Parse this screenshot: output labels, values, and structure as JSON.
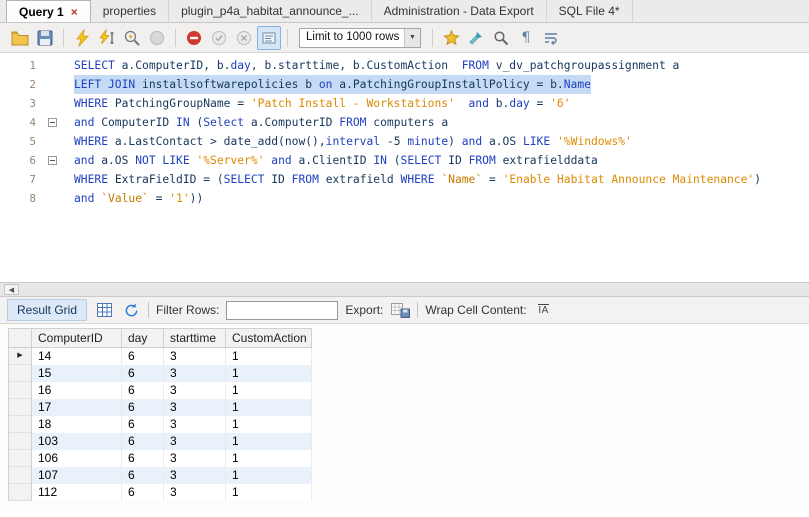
{
  "colors": {
    "keyword": "#2040c0",
    "identifier": "#16365c",
    "string": "#dd8a00",
    "backtick": "#c77c00",
    "line_number": "#9b8671",
    "selected_line_bg": "#c5dbf5",
    "alt_row_bg": "#e9f1fb"
  },
  "tab_bar": {
    "tabs": [
      {
        "label": "Query 1",
        "active": true,
        "close": "×"
      },
      {
        "label": "properties",
        "active": false
      },
      {
        "label": "plugin_p4a_habitat_announce_...",
        "active": false
      },
      {
        "label": "Administration - Data Export",
        "active": false
      },
      {
        "label": "SQL File 4*",
        "active": false
      }
    ]
  },
  "toolbar": {
    "items": [
      {
        "icon": "open-script-icon"
      },
      {
        "icon": "save-script-icon"
      },
      {
        "sep": true
      },
      {
        "icon": "execute-icon"
      },
      {
        "icon": "execute-current-icon"
      },
      {
        "icon": "explain-icon"
      },
      {
        "icon": "stop-icon",
        "disabled": true
      },
      {
        "sep": true
      },
      {
        "icon": "stop-on-error-icon"
      },
      {
        "icon": "commit-icon",
        "disabled": true
      },
      {
        "icon": "rollback-icon",
        "disabled": true
      },
      {
        "icon": "autocommit-icon",
        "toggled": true
      },
      {
        "sep": true
      },
      {
        "dropdown": "Limit to 1000 rows"
      },
      {
        "sep": true
      },
      {
        "icon": "save-snippet-icon"
      },
      {
        "icon": "beautify-icon"
      },
      {
        "icon": "find-icon"
      },
      {
        "icon": "invisible-chars-icon"
      },
      {
        "icon": "wrap-text-icon"
      }
    ]
  },
  "editor": {
    "lines": [
      {
        "num": "1",
        "fold": false,
        "selected": false,
        "segments": [
          {
            "t": "kw",
            "v": "SELECT"
          },
          {
            "t": "id",
            "v": " a.ComputerID, b."
          },
          {
            "t": "kw",
            "v": "day"
          },
          {
            "t": "id",
            "v": ", b.starttime, b.CustomAction  "
          },
          {
            "t": "kw",
            "v": "FROM"
          },
          {
            "t": "id",
            "v": " v_dv_patchgroupassignment a"
          }
        ]
      },
      {
        "num": "2",
        "fold": false,
        "selected": true,
        "segments": [
          {
            "t": "kw",
            "v": "LEFT JOIN"
          },
          {
            "t": "id",
            "v": " installsoftwarepolicies b "
          },
          {
            "t": "kw",
            "v": "on"
          },
          {
            "t": "id",
            "v": " a.PatchingGroupInstallPolicy = b."
          },
          {
            "t": "kw",
            "v": "Name"
          }
        ]
      },
      {
        "num": "3",
        "fold": false,
        "selected": false,
        "segments": [
          {
            "t": "kw",
            "v": "WHERE"
          },
          {
            "t": "id",
            "v": " PatchingGroupName = "
          },
          {
            "t": "str",
            "v": "'Patch Install - Workstations'"
          },
          {
            "t": "id",
            "v": "  "
          },
          {
            "t": "kw",
            "v": "and"
          },
          {
            "t": "id",
            "v": " b."
          },
          {
            "t": "kw",
            "v": "day"
          },
          {
            "t": "id",
            "v": " = "
          },
          {
            "t": "str",
            "v": "'6'"
          }
        ]
      },
      {
        "num": "4",
        "fold": true,
        "selected": false,
        "segments": [
          {
            "t": "kw",
            "v": "and"
          },
          {
            "t": "id",
            "v": " ComputerID "
          },
          {
            "t": "kw",
            "v": "IN"
          },
          {
            "t": "id",
            "v": " ("
          },
          {
            "t": "kw",
            "v": "Select"
          },
          {
            "t": "id",
            "v": " a.ComputerID "
          },
          {
            "t": "kw",
            "v": "FROM"
          },
          {
            "t": "id",
            "v": " computers a"
          }
        ]
      },
      {
        "num": "5",
        "fold": false,
        "selected": false,
        "segments": [
          {
            "t": "kw",
            "v": "WHERE"
          },
          {
            "t": "id",
            "v": " a.LastContact > date_add(now(),"
          },
          {
            "t": "kw",
            "v": "interval"
          },
          {
            "t": "id",
            "v": " -5 "
          },
          {
            "t": "kw",
            "v": "minute"
          },
          {
            "t": "id",
            "v": ") "
          },
          {
            "t": "kw",
            "v": "and"
          },
          {
            "t": "id",
            "v": " a.OS "
          },
          {
            "t": "kw",
            "v": "LIKE"
          },
          {
            "t": "id",
            "v": " "
          },
          {
            "t": "str",
            "v": "'%Windows%'"
          }
        ]
      },
      {
        "num": "6",
        "fold": true,
        "selected": false,
        "segments": [
          {
            "t": "kw",
            "v": "and"
          },
          {
            "t": "id",
            "v": " a.OS "
          },
          {
            "t": "kw",
            "v": "NOT LIKE"
          },
          {
            "t": "id",
            "v": " "
          },
          {
            "t": "str",
            "v": "'%Server%'"
          },
          {
            "t": "id",
            "v": " "
          },
          {
            "t": "kw",
            "v": "and"
          },
          {
            "t": "id",
            "v": " a.ClientID "
          },
          {
            "t": "kw",
            "v": "IN"
          },
          {
            "t": "id",
            "v": " ("
          },
          {
            "t": "kw",
            "v": "SELECT"
          },
          {
            "t": "id",
            "v": " ID "
          },
          {
            "t": "kw",
            "v": "FROM"
          },
          {
            "t": "id",
            "v": " extrafielddata"
          }
        ]
      },
      {
        "num": "7",
        "fold": false,
        "selected": false,
        "segments": [
          {
            "t": "kw",
            "v": "WHERE"
          },
          {
            "t": "id",
            "v": " ExtraFieldID = ("
          },
          {
            "t": "kw",
            "v": "SELECT"
          },
          {
            "t": "id",
            "v": " ID "
          },
          {
            "t": "kw",
            "v": "FROM"
          },
          {
            "t": "id",
            "v": " extrafield "
          },
          {
            "t": "kw",
            "v": "WHERE"
          },
          {
            "t": "id",
            "v": " "
          },
          {
            "t": "bt",
            "v": "`Name`"
          },
          {
            "t": "id",
            "v": " = "
          },
          {
            "t": "str",
            "v": "'Enable Habitat Announce Maintenance'"
          },
          {
            "t": "id",
            "v": ")"
          }
        ]
      },
      {
        "num": "8",
        "fold": false,
        "selected": false,
        "segments": [
          {
            "t": "kw",
            "v": "and"
          },
          {
            "t": "id",
            "v": " "
          },
          {
            "t": "bt",
            "v": "`Value`"
          },
          {
            "t": "id",
            "v": " = "
          },
          {
            "t": "str",
            "v": "'1'"
          },
          {
            "t": "id",
            "v": "))"
          }
        ]
      }
    ]
  },
  "result_panel": {
    "result_grid_label": "Result Grid",
    "filter_label": "Filter Rows:",
    "filter_value": "",
    "export_label": "Export:",
    "wrap_label": "Wrap Cell Content:",
    "icons": [
      "grid-view-icon",
      "refresh-icon",
      "export-icon",
      "wrap-cell-icon"
    ]
  },
  "grid": {
    "columns": [
      "ComputerID",
      "day",
      "starttime",
      "CustomAction"
    ],
    "rows": [
      {
        "cells": [
          "14",
          "6",
          "3",
          "1"
        ],
        "current": true
      },
      {
        "cells": [
          "15",
          "6",
          "3",
          "1"
        ]
      },
      {
        "cells": [
          "16",
          "6",
          "3",
          "1"
        ]
      },
      {
        "cells": [
          "17",
          "6",
          "3",
          "1"
        ]
      },
      {
        "cells": [
          "18",
          "6",
          "3",
          "1"
        ]
      },
      {
        "cells": [
          "103",
          "6",
          "3",
          "1"
        ]
      },
      {
        "cells": [
          "106",
          "6",
          "3",
          "1"
        ]
      },
      {
        "cells": [
          "107",
          "6",
          "3",
          "1"
        ]
      },
      {
        "cells": [
          "112",
          "6",
          "3",
          "1"
        ]
      }
    ]
  }
}
